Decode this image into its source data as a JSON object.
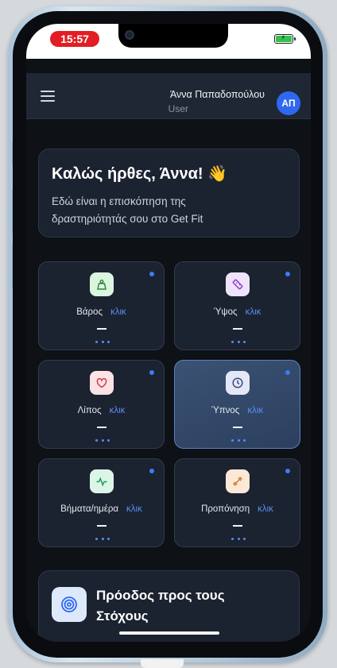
{
  "status": {
    "time": "15:57"
  },
  "header": {
    "user_name": "Άννα Παπαδοπούλου",
    "user_role": "User",
    "avatar_initials": "ΑΠ"
  },
  "welcome": {
    "title": "Καλώς ήρθες, Άννα! 👋",
    "text": "Εδώ είναι η επισκόπηση της δραστηριότητάς σου στο Get Fit"
  },
  "metrics": [
    {
      "label": "Βάρος",
      "action": "κλικ",
      "value": "—",
      "icon": "scale-icon",
      "icon_bg": "#dcf5df",
      "icon_color": "#2c8a3c"
    },
    {
      "label": "Ύψος",
      "action": "κλικ",
      "value": "—",
      "icon": "ruler-icon",
      "icon_bg": "#efe3fb",
      "icon_color": "#8b44c9"
    },
    {
      "label": "Λίπος",
      "action": "κλικ",
      "value": "—",
      "icon": "heart-icon",
      "icon_bg": "#fbe2e4",
      "icon_color": "#d03a4a"
    },
    {
      "label": "Ύπνος",
      "action": "κλικ",
      "value": "—",
      "icon": "clock-icon",
      "icon_bg": "#e4e8f6",
      "icon_color": "#3b4c7d",
      "selected": true
    },
    {
      "label": "Βήματα/ημέρα",
      "action": "κλικ",
      "value": "—",
      "icon": "activity-icon",
      "icon_bg": "#dcf5e7",
      "icon_color": "#1f9a5a"
    },
    {
      "label": "Προπόνηση",
      "action": "κλικ",
      "value": "—",
      "icon": "dumbbell-icon",
      "icon_bg": "#fbe8d7",
      "icon_color": "#d87a2a"
    }
  ],
  "progress": {
    "title": "Πρόοδος προς τους Στόχους",
    "icon": "target-icon"
  },
  "colors": {
    "accent": "#2e68f1",
    "background": "#0e1116",
    "card": "#1b2230",
    "status_pill": "#e21d23"
  }
}
